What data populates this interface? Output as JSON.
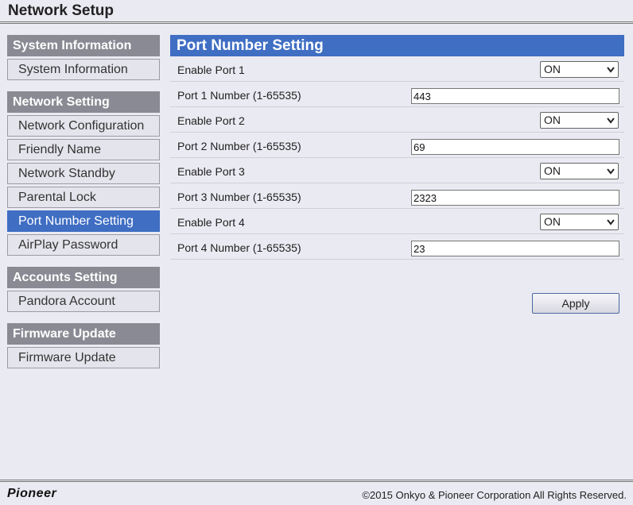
{
  "app": {
    "title": "Network Setup"
  },
  "sidebar": {
    "sections": [
      {
        "heading": "System Information",
        "items": [
          "System Information"
        ]
      },
      {
        "heading": "Network Setting",
        "items": [
          "Network Configuration",
          "Friendly Name",
          "Network Standby",
          "Parental Lock",
          "Port Number Setting",
          "AirPlay Password"
        ]
      },
      {
        "heading": "Accounts Setting",
        "items": [
          "Pandora Account"
        ]
      },
      {
        "heading": "Firmware Update",
        "items": [
          "Firmware Update"
        ]
      }
    ],
    "active_item": "Port Number Setting"
  },
  "main": {
    "title": "Port Number Setting",
    "rows": [
      {
        "label": "Enable Port 1",
        "type": "select",
        "value": "ON"
      },
      {
        "label": "Port 1 Number (1-65535)",
        "type": "input",
        "value": "443"
      },
      {
        "label": "Enable Port 2",
        "type": "select",
        "value": "ON"
      },
      {
        "label": "Port 2 Number (1-65535)",
        "type": "input",
        "value": "69"
      },
      {
        "label": "Enable Port 3",
        "type": "select",
        "value": "ON"
      },
      {
        "label": "Port 3 Number (1-65535)",
        "type": "input",
        "value": "2323"
      },
      {
        "label": "Enable Port 4",
        "type": "select",
        "value": "ON"
      },
      {
        "label": "Port 4 Number (1-65535)",
        "type": "input",
        "value": "23"
      }
    ],
    "apply_label": "Apply"
  },
  "footer": {
    "brand": "Pioneer",
    "copyright": "©2015 Onkyo & Pioneer Corporation All Rights Reserved."
  },
  "colors": {
    "accent": "#3f6ec3",
    "section_header": "#8a8a94",
    "background": "#eaeaf2"
  },
  "icons": {
    "select_arrow": "chevron-down-icon"
  }
}
